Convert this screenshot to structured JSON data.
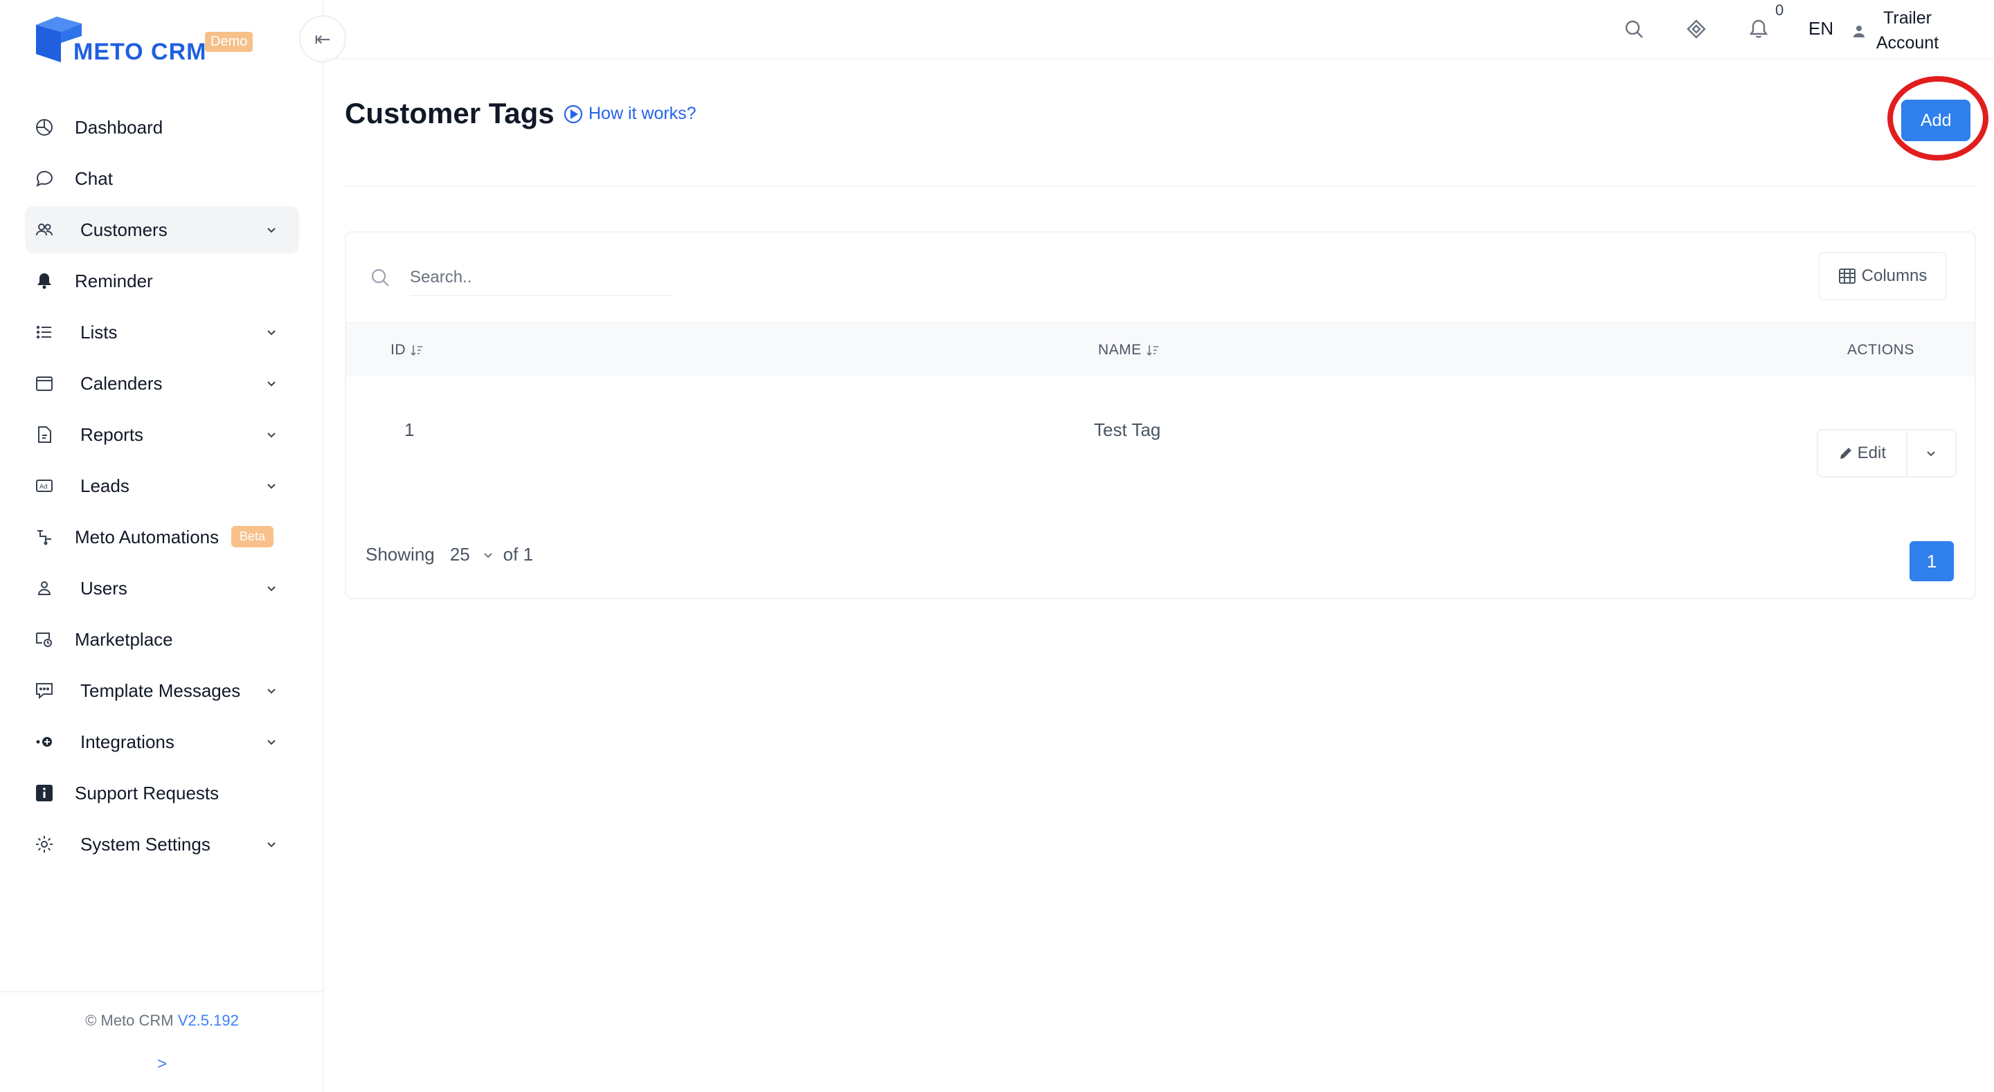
{
  "brand": {
    "name": "METO CRM",
    "badge": "Demo",
    "primary_color": "#1f5fe0"
  },
  "sidebar": {
    "items": [
      {
        "label": "Dashboard",
        "icon": "dashboard-icon",
        "has_children": false,
        "active": false
      },
      {
        "label": "Chat",
        "icon": "chat-icon",
        "has_children": false,
        "active": false
      },
      {
        "label": "Customers",
        "icon": "customers-icon",
        "has_children": true,
        "active": true
      },
      {
        "label": "Reminder",
        "icon": "bell-icon",
        "has_children": false,
        "active": false
      },
      {
        "label": "Lists",
        "icon": "list-icon",
        "has_children": true,
        "active": false
      },
      {
        "label": "Calenders",
        "icon": "calendar-icon",
        "has_children": true,
        "active": false
      },
      {
        "label": "Reports",
        "icon": "report-icon",
        "has_children": true,
        "active": false
      },
      {
        "label": "Leads",
        "icon": "ad-icon",
        "has_children": true,
        "active": false
      },
      {
        "label": "Meto Automations",
        "icon": "automation-icon",
        "has_children": false,
        "active": false,
        "badge": "Beta"
      },
      {
        "label": "Users",
        "icon": "user-icon",
        "has_children": true,
        "active": false
      },
      {
        "label": "Marketplace",
        "icon": "marketplace-icon",
        "has_children": false,
        "active": false
      },
      {
        "label": "Template Messages",
        "icon": "template-icon",
        "has_children": true,
        "active": false
      },
      {
        "label": "Integrations",
        "icon": "integrations-icon",
        "has_children": true,
        "active": false
      },
      {
        "label": "Support Requests",
        "icon": "info-icon",
        "has_children": false,
        "active": false
      },
      {
        "label": "System Settings",
        "icon": "gear-icon",
        "has_children": true,
        "active": false
      }
    ],
    "footer": {
      "copyright": "© Meto CRM",
      "version": "V2.5.192",
      "expand": ">"
    },
    "collapse_icon": "collapse-left-icon"
  },
  "topbar": {
    "notification_count": "0",
    "language": "EN",
    "account_line1": "Trailer",
    "account_line2": "Account"
  },
  "page": {
    "title": "Customer Tags",
    "how_it_works": "How it works?",
    "add_label": "Add",
    "highlight_color": "#e11d1d",
    "accent_color": "#2f80ed"
  },
  "table": {
    "search_placeholder": "Search..",
    "columns_label": "Columns",
    "headers": {
      "id": "ID",
      "name": "NAME",
      "actions": "ACTIONS"
    },
    "rows": [
      {
        "id": "1",
        "name": "Test Tag",
        "action": "Edit"
      }
    ],
    "footer": {
      "showing": "Showing",
      "page_size": "25",
      "of": "of 1",
      "current_page": "1"
    }
  }
}
